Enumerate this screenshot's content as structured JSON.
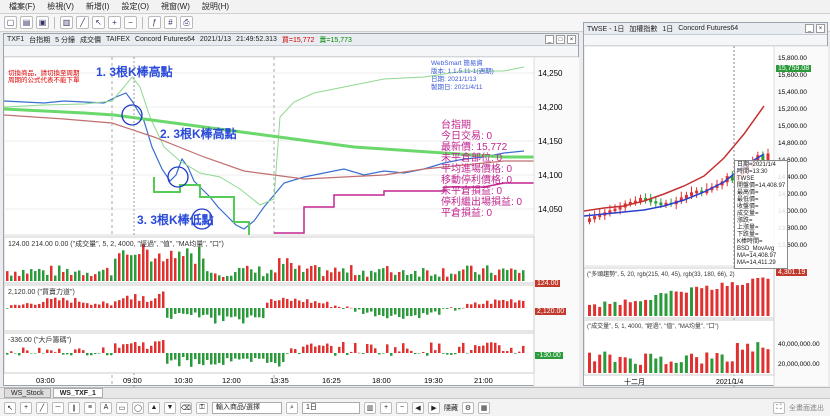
{
  "menu": [
    "檔案(F)",
    "檢視(V)",
    "新增(I)",
    "設定(O)",
    "視窗(W)",
    "說明(H)"
  ],
  "left_window": {
    "title_items": [
      "TXF1",
      "台指期",
      "5 分鐘",
      "成交價",
      "TAIFEX",
      "Concord Futures64",
      "2021/1/13",
      "21:49:52.313",
      "買=15,772",
      "賣=15,773"
    ],
    "red_text": [
      "切換商品，請切換至周期",
      "周期的公式代表不能下單"
    ],
    "price_axis": [
      "14,250",
      "14,200",
      "14,150",
      "14,100",
      "14,050"
    ],
    "time_axis": [
      "03:00",
      "09:00",
      "10:30",
      "12:00",
      "13:35",
      "16:25",
      "18:00",
      "19:30",
      "21:00"
    ],
    "websmart": [
      "WebSmart 簡易資",
      "版本: 1.1.5.11-1(週期)",
      "日期: 2021/1/13",
      "製期日: 2021/4/11"
    ],
    "info_lines": [
      "台指期",
      "今日交易: 0",
      "最新價: 15,772",
      "未平倉部位: 0",
      "平均進場價格: 0",
      "移動停利價格: 0",
      "未平倉損益: 0",
      "停利繼出場損益: 0",
      "平倉損益: 0"
    ],
    "annotations": [
      "1. 3根K棒高點",
      "2. 3根K棒高點",
      "3. 3根K棒低點"
    ],
    "volume_title": "124.00  214.00  0.00  (\"成交量\", 5, 2, 4000, \"經過\", \"值\", \"MA均量\", \"口\")",
    "volume_tag": "124.00",
    "indicator2_title": "2,120.00  (\"買賣力道\")",
    "indicator2_tag": "2,120.00",
    "indicator3_title": "-336.00  (\"大戶籌碼\")",
    "indicator3_tag": "-130.00"
  },
  "right_window": {
    "title_items": [
      "TWSE - 1日",
      "加權指數",
      "1日",
      "Concord Futures64"
    ],
    "price_axis": [
      "15,800.00",
      "15,600.00",
      "15,400.00",
      "15,200.00",
      "15,000.00",
      "14,800.00",
      "14,600.00",
      "14,400.00",
      "14,200.00",
      "14,000.00",
      "13,800.00",
      "13,600.00"
    ],
    "top_tag": "15,759.08",
    "tooltip": [
      "日期=2021/1/4",
      "時間=13:30",
      "TWSE",
      "開盤價=14,408.97",
      "最高價=",
      "最低價=",
      "收盤價=",
      "成交量=",
      "漲跌=",
      "上漲量=",
      "下跌量=",
      "K棒時間=",
      "BSD_MovAvg",
      "MA=14,408.97",
      "MA=14,411.29"
    ],
    "indicator_title": "(\"多頭趨勢\", 5, 20, rgb(215, 40, 45), rgb(33, 180, 66), 2)",
    "indicator_tag": "4,301.19",
    "vol_title": "(\"成交量\", 5, 1, 4000, \"經過\", \"值\", \"MA均量\", \"口\")",
    "vol_axis": [
      "40,000,000.00",
      "20,000,000.00"
    ],
    "time_axis": [
      "十二月",
      "2021/1/4"
    ]
  },
  "tabs": [
    "WS_Stock",
    "WS_TXF_1"
  ],
  "bottom": {
    "symbol_placeholder": "輸入商品/選擇",
    "period": "1日",
    "btn1": "隱藏",
    "btn2": "全畫面進出"
  },
  "colors": {
    "red_candle": "#e03030",
    "green_candle": "#2a9a3a",
    "ma_blue": "#2a3fd0",
    "ma_red": "#c23030",
    "annot_blue": "#2a4bd8",
    "magenta": "#c0268f"
  }
}
